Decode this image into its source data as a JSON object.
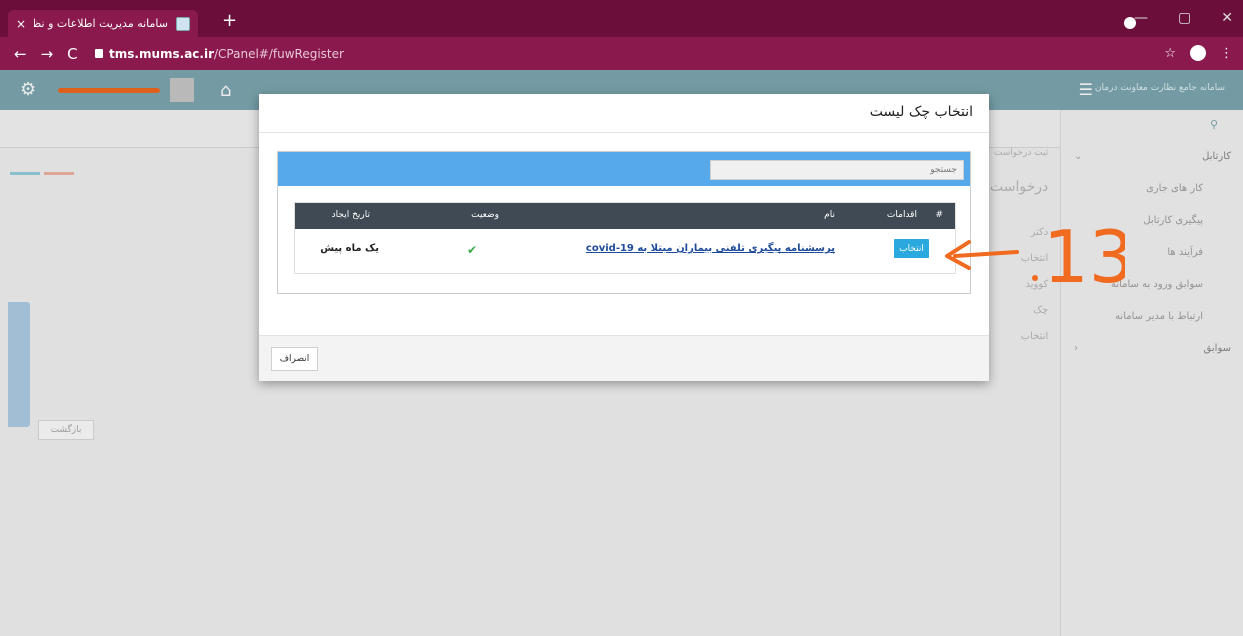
{
  "browser": {
    "tab_title": "سامانه مدیریت اطلاعات و نظارت",
    "tab_close": "×",
    "new_tab": "+",
    "url_host": "tms.mums.ac.ir",
    "url_path": "/CPanel#/fuwRegister",
    "back": "←",
    "forward": "→",
    "reload": "C",
    "star": "☆",
    "menu": "⋮",
    "win_min": "—",
    "win_max": "▢",
    "win_close": "✕"
  },
  "app": {
    "title": "سامانه جامع نظارت معاونت درمان",
    "back_button": "بازگشت",
    "gear_icon": "gear-icon",
    "home_icon": "home-icon",
    "menu_icon": "☰"
  },
  "sidebar": {
    "search_icon": "search-icon",
    "items": [
      {
        "label": "کارتابل",
        "chevron": "⌄"
      },
      {
        "label": "کار های جاری"
      },
      {
        "label": "پیگیری کارتابل"
      },
      {
        "label": "فرآیند ها"
      },
      {
        "label": "سوابق ورود به سامانه"
      },
      {
        "label": "ارتباط با مدیر سامانه"
      },
      {
        "label": "سوابق",
        "chevron": "‹"
      }
    ]
  },
  "background": {
    "register_label": "ثبت درخواست",
    "request_heading": "درخواست",
    "line1": "دکتر",
    "line2": "انتخاب",
    "line3": "کووید",
    "line4": "چک",
    "line5": "انتخاب"
  },
  "modal": {
    "title": "انتخاب چک لیست",
    "search_placeholder": "جستجو",
    "columns": {
      "index": "#",
      "actions": "اقدامات",
      "name": "نام",
      "status": "وضعیت",
      "created": "تاریخ ایجاد"
    },
    "rows": [
      {
        "action": "انتخاب",
        "name": "پرسشنامه پیگیری تلفنی بیماران مبتلا به covid-19",
        "status_icon": "check-icon",
        "created": "یک ماه پیش"
      }
    ],
    "cancel": "انصراف"
  },
  "annotation": {
    "label": ".13",
    "color": "#f06a1f"
  }
}
